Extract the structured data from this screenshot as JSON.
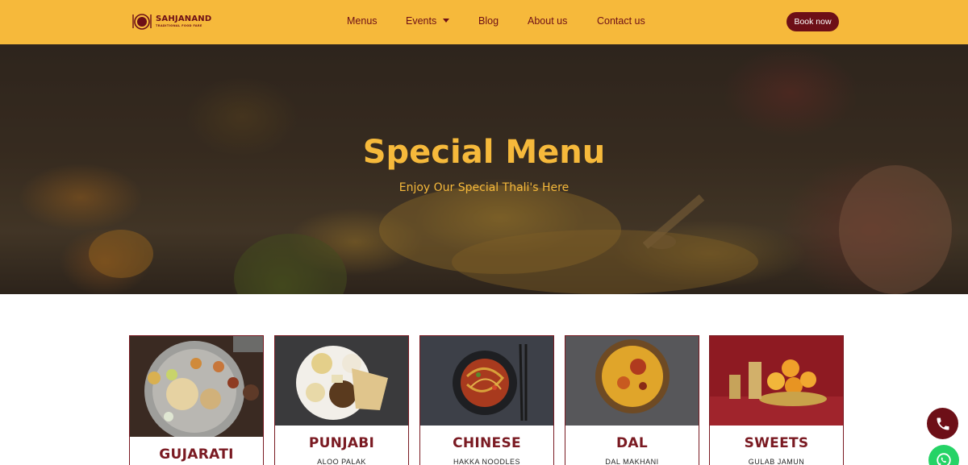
{
  "brand": {
    "name": "SAHJANAND",
    "tagline": "TRADITIONAL FOOD FARE"
  },
  "nav": {
    "items": [
      "Menus",
      "Events",
      "Blog",
      "About us",
      "Contact us"
    ],
    "book_label": "Book now"
  },
  "hero": {
    "title": "Special Menu",
    "subtitle": "Enjoy Our Special Thali's Here"
  },
  "cards": [
    {
      "title": "GUJARATI",
      "item": ""
    },
    {
      "title": "PUNJABI",
      "item": "ALOO PALAK"
    },
    {
      "title": "CHINESE",
      "item": "HAKKA NOODLES"
    },
    {
      "title": "DAL",
      "item": "DAL MAKHANI"
    },
    {
      "title": "SWEETS",
      "item": "GULAB JAMUN"
    }
  ],
  "colors": {
    "header_bg": "#f6b93b",
    "accent": "#6d0f17",
    "whatsapp": "#25d366"
  },
  "icons": [
    "logo-plate-icon",
    "chevron-down-icon",
    "phone-icon",
    "whatsapp-icon"
  ]
}
